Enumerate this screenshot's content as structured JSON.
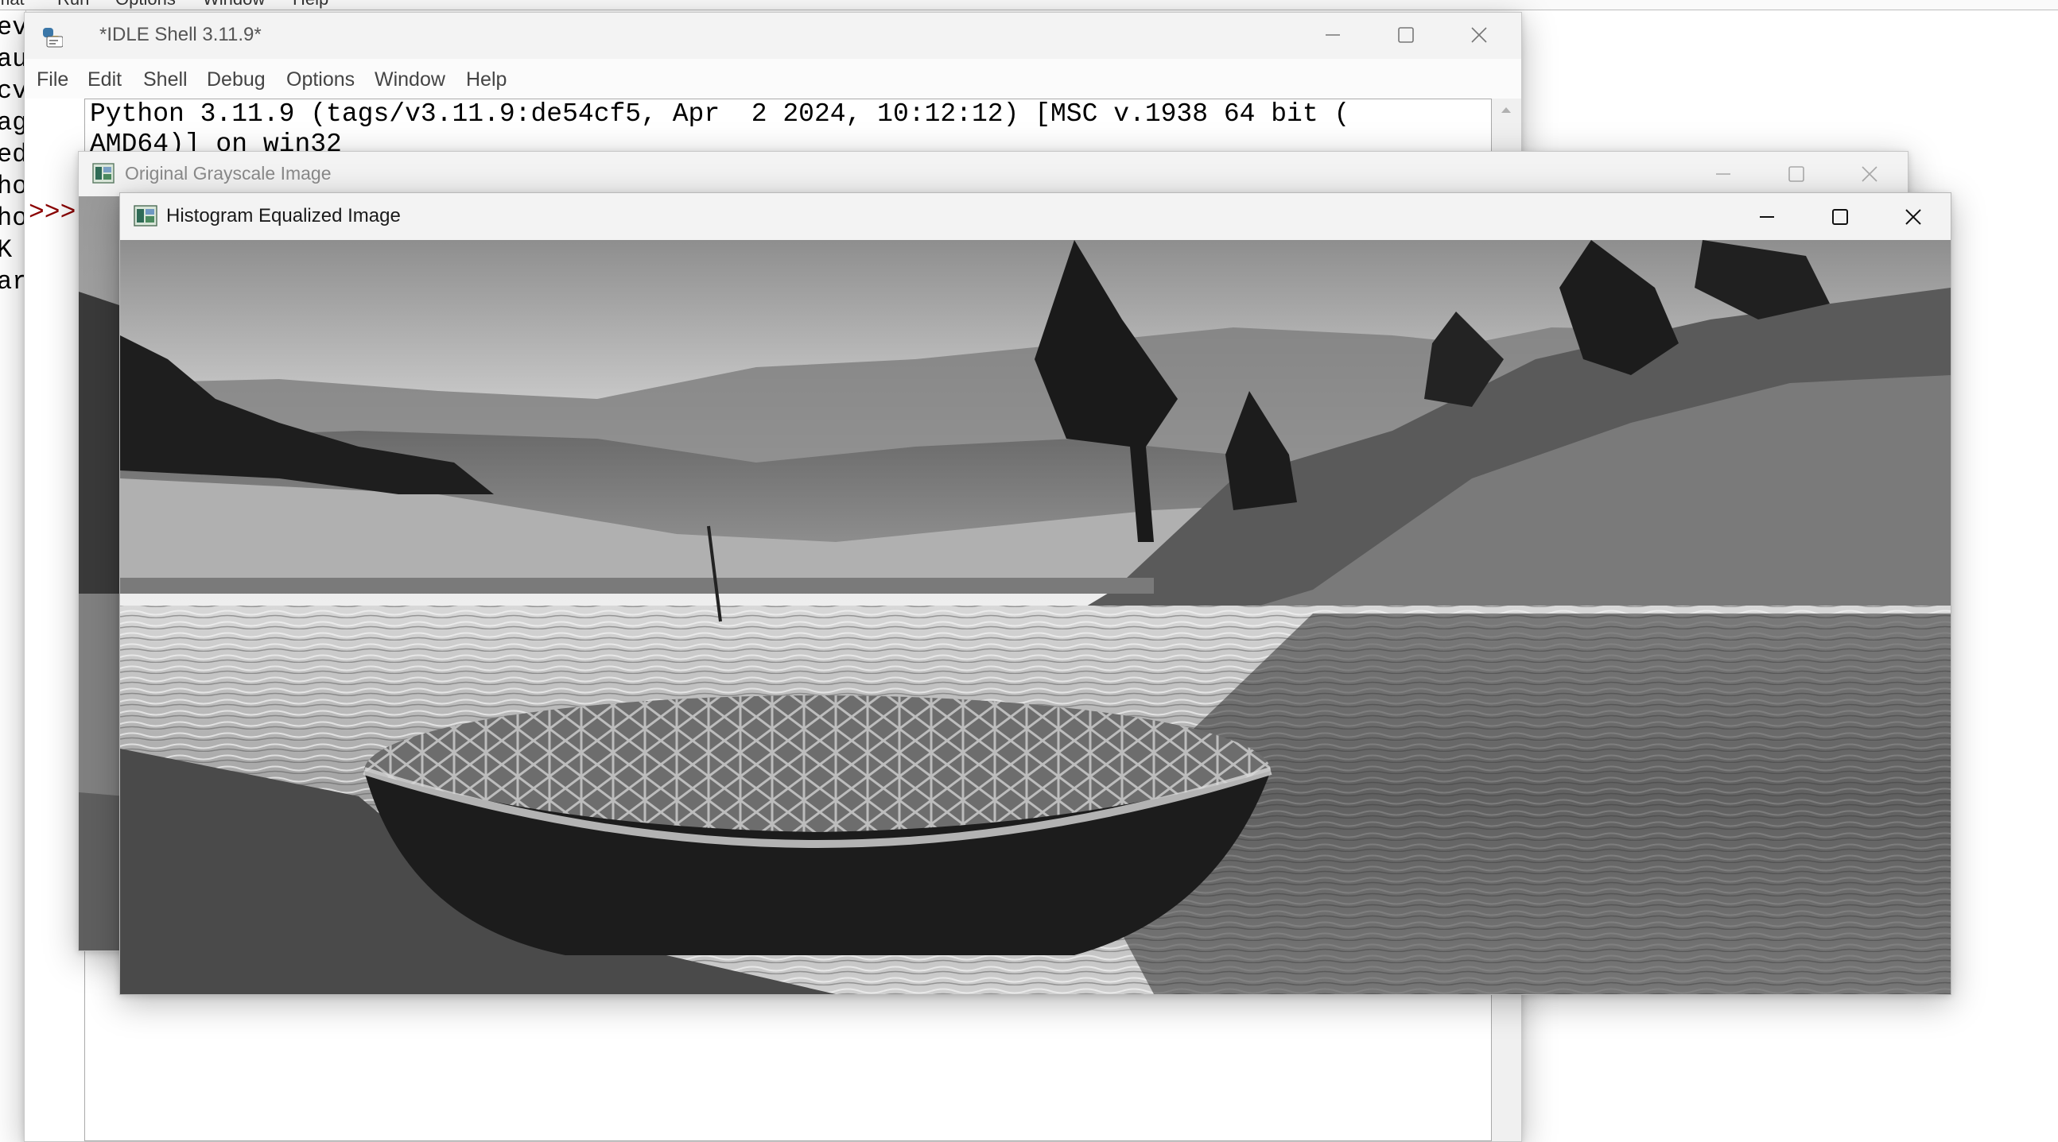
{
  "background_editor": {
    "menu": [
      "mat",
      "Run",
      "Options",
      "Window",
      "Help"
    ],
    "code_fragments": [
      "ev",
      "au",
      "cv",
      "ag",
      "ed",
      "ho",
      "ho",
      "K",
      "ar"
    ]
  },
  "idle_shell": {
    "title": "*IDLE Shell 3.11.9*",
    "menu": [
      "File",
      "Edit",
      "Shell",
      "Debug",
      "Options",
      "Window",
      "Help"
    ],
    "output_lines": [
      "Python 3.11.9 (tags/v3.11.9:de54cf5, Apr  2 2024, 10:12:12) [MSC v.1938 64 bit (",
      "AMD64)] on win32"
    ],
    "prompt": ">>>"
  },
  "original_window": {
    "title": "Original Grayscale Image"
  },
  "equalized_window": {
    "title": "Histogram Equalized Image"
  },
  "window_controls": {
    "minimize_icon": "minimize-icon",
    "maximize_icon": "maximize-icon",
    "close_icon": "close-icon"
  }
}
